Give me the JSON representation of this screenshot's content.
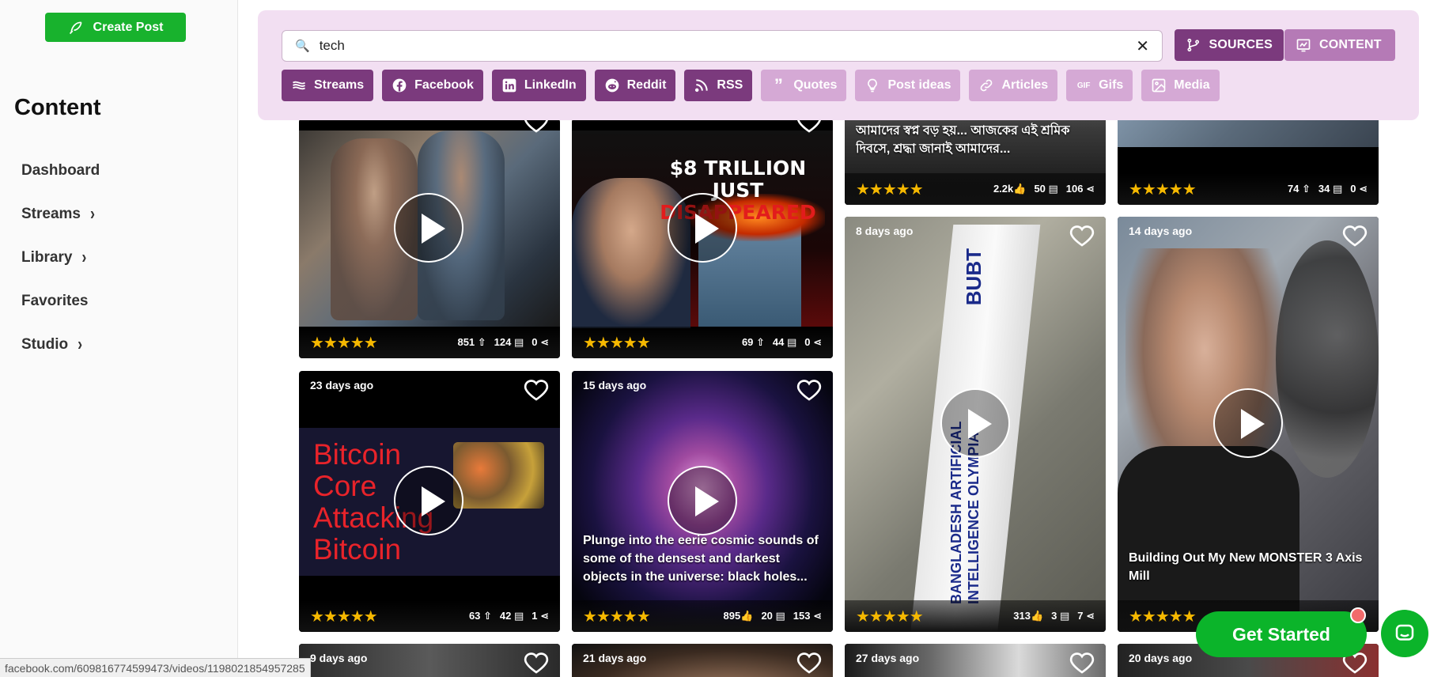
{
  "sidebar": {
    "create_post_label": "Create Post",
    "heading": "Content",
    "items": [
      {
        "label": "Dashboard",
        "chevron": false
      },
      {
        "label": "Streams",
        "chevron": true
      },
      {
        "label": "Library",
        "chevron": true
      },
      {
        "label": "Favorites",
        "chevron": false
      },
      {
        "label": "Studio",
        "chevron": true
      }
    ]
  },
  "search": {
    "value": "tech",
    "tabs": {
      "sources": "SOURCES",
      "content": "CONTENT"
    },
    "chips": [
      {
        "label": "Streams",
        "icon": "streams-icon",
        "active": true
      },
      {
        "label": "Facebook",
        "icon": "facebook-icon",
        "active": true
      },
      {
        "label": "LinkedIn",
        "icon": "linkedin-icon",
        "active": true
      },
      {
        "label": "Reddit",
        "icon": "reddit-icon",
        "active": true
      },
      {
        "label": "RSS",
        "icon": "rss-icon",
        "active": true
      },
      {
        "label": "Quotes",
        "icon": "quotes-icon",
        "active": false
      },
      {
        "label": "Post ideas",
        "icon": "lightbulb-icon",
        "active": false
      },
      {
        "label": "Articles",
        "icon": "link-icon",
        "active": false
      },
      {
        "label": "Gifs",
        "icon": "gif-icon",
        "active": false
      },
      {
        "label": "Media",
        "icon": "media-icon",
        "active": false
      }
    ]
  },
  "cards": {
    "c1": {
      "rating": "★★★★★",
      "s1": "851 ⇧",
      "s2": "124 ▤",
      "s3": "0 ⋖"
    },
    "c2": {
      "rating": "★★★★★",
      "s1": "69 ⇧",
      "s2": "44 ▤",
      "s3": "0 ⋖",
      "headline1": "$8 TRILLION JUST",
      "headline2": "DISAPPEARED"
    },
    "c3": {
      "rating": "★★★★★",
      "s1": "2.2k👍",
      "s2": "50 ▤",
      "s3": "106 ⋖",
      "caption": "আমাদের স্বপ্ন বড় হয়... আজকের এই শ্রমিক দিবসে, শ্রদ্ধা জানাই আমাদের..."
    },
    "c4": {
      "rating": "★★★★★",
      "s1": "74 ⇧",
      "s2": "34 ▤",
      "s3": "0 ⋖"
    },
    "c5": {
      "ago": "23 days ago",
      "rating": "★★★★★",
      "s1": "63 ⇧",
      "s2": "42 ▤",
      "s3": "1 ⋖",
      "art_text": "Bitcoin Core Attacking Bitcoin"
    },
    "c6": {
      "ago": "15 days ago",
      "rating": "★★★★★",
      "s1": "895👍",
      "s2": "20 ▤",
      "s3": "153 ⋖",
      "caption": "Plunge into the eerie cosmic sounds of some of the densest and darkest objects in the universe: black holes..."
    },
    "c7": {
      "ago": "8 days ago",
      "rating": "★★★★★",
      "s1": "313👍",
      "s2": "3 ▤",
      "s3": "7 ⋖",
      "banner_text": "BANGLADESH ARTIFICIAL INTELLIGENCE OLYMPIAD",
      "banner_top": "BUBT"
    },
    "c8": {
      "ago": "14 days ago",
      "rating": "★★★★★",
      "caption": "Building Out My New MONSTER 3 Axis Mill"
    },
    "c9": {
      "ago": "9 days ago"
    },
    "c10": {
      "ago": "21 days ago"
    },
    "c11": {
      "ago": "27 days ago"
    },
    "c12": {
      "ago": "20 days ago"
    }
  },
  "floating": {
    "get_started": "Get Started",
    "status_url": "facebook.com/609816774599473/videos/1198021854957285"
  },
  "colors": {
    "primary_green": "#18b22d",
    "purple_active": "#7b3a7d",
    "purple_inactive": "#d5a9d5",
    "panel_bg": "#f2dff2",
    "star": "#f5b800"
  }
}
